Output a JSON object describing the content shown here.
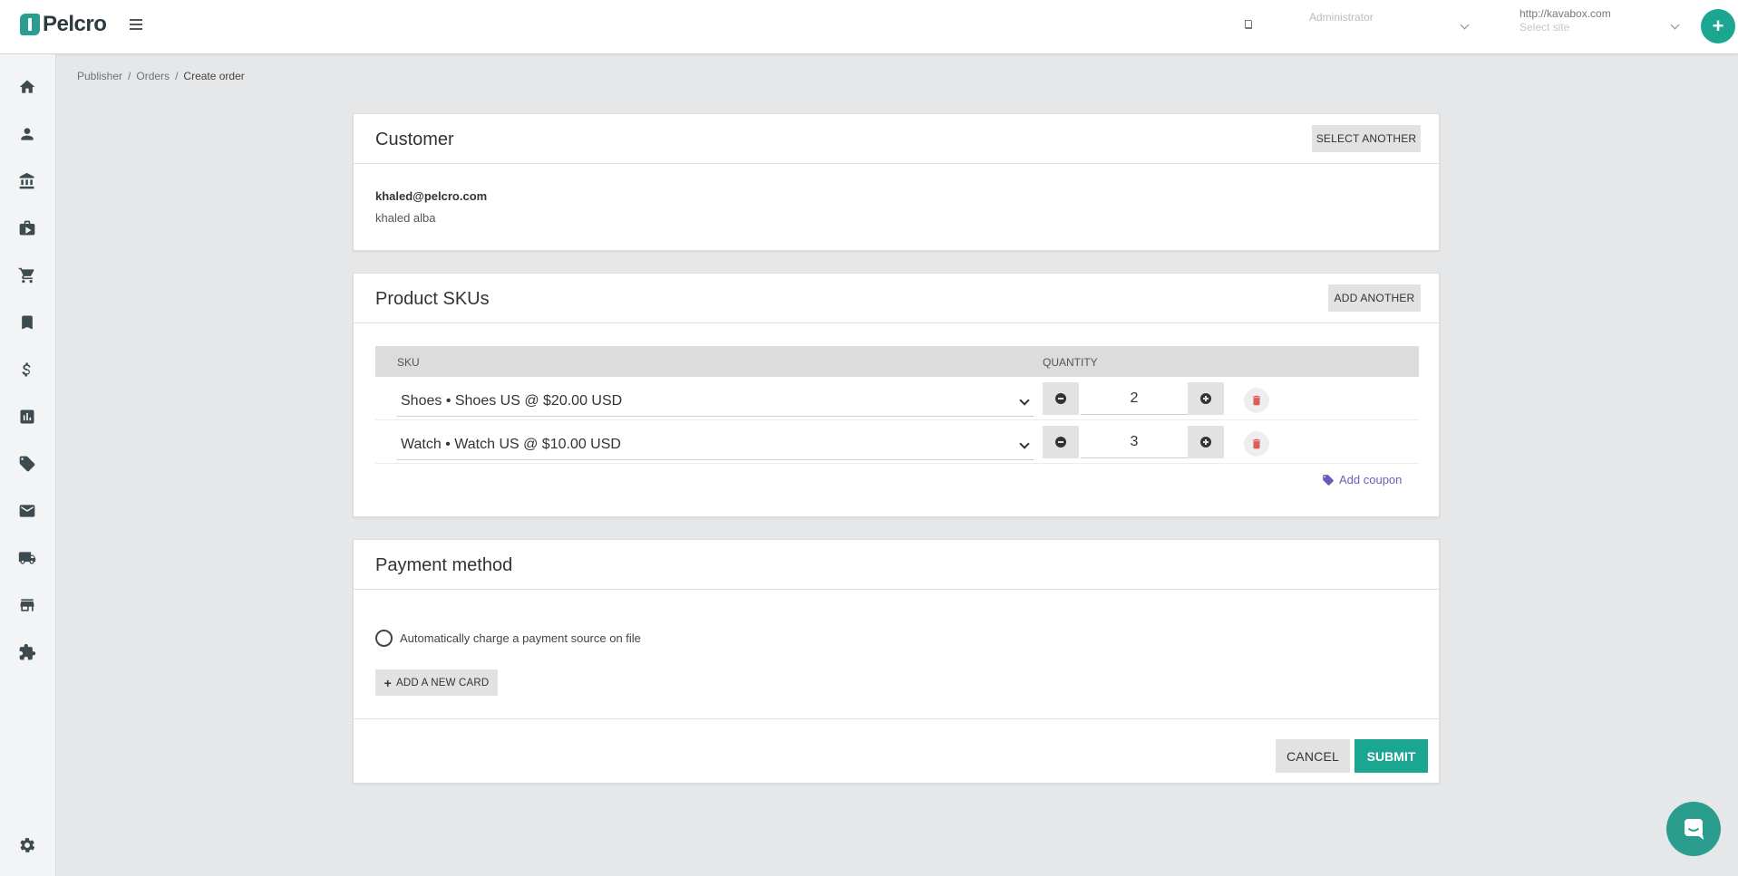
{
  "header": {
    "logo_text": "Pelcro",
    "role_select": {
      "value": "Administrator"
    },
    "site_select": {
      "value": "http://kavabox.com",
      "placeholder": "Select site"
    },
    "add_button": "+"
  },
  "sidebar": {
    "items": [
      {
        "icon": "home-icon"
      },
      {
        "icon": "person-icon"
      },
      {
        "icon": "bank-icon"
      },
      {
        "icon": "briefcase-icon"
      },
      {
        "icon": "cart-icon"
      },
      {
        "icon": "bookmark-icon"
      },
      {
        "icon": "dollar-icon"
      },
      {
        "icon": "chart-icon"
      },
      {
        "icon": "ticket-icon"
      },
      {
        "icon": "mail-icon"
      },
      {
        "icon": "truck-icon"
      },
      {
        "icon": "store-icon"
      },
      {
        "icon": "puzzle-icon"
      },
      {
        "icon": "gear-icon"
      }
    ]
  },
  "breadcrumb": [
    "Publisher",
    "Orders",
    "Create order"
  ],
  "customer": {
    "title": "Customer",
    "select_another": "SELECT ANOTHER",
    "email": "khaled@pelcro.com",
    "name": "khaled alba"
  },
  "skus": {
    "title": "Product SKUs",
    "add_another": "ADD ANOTHER",
    "col_sku": "SKU",
    "col_quantity": "QUANTITY",
    "rows": [
      {
        "sku": "Shoes • Shoes US @ $20.00 USD",
        "quantity": "2"
      },
      {
        "sku": "Watch • Watch US @ $10.00 USD",
        "quantity": "3"
      }
    ],
    "add_coupon": "Add coupon"
  },
  "payment": {
    "title": "Payment method",
    "auto_charge_label": "Automatically charge a payment source on file",
    "add_card": "ADD A NEW CARD",
    "cancel": "CANCEL",
    "submit": "SUBMIT"
  },
  "colors": {
    "accent": "#1ba692",
    "danger": "#e05a5a",
    "link": "#6a5bb8"
  }
}
